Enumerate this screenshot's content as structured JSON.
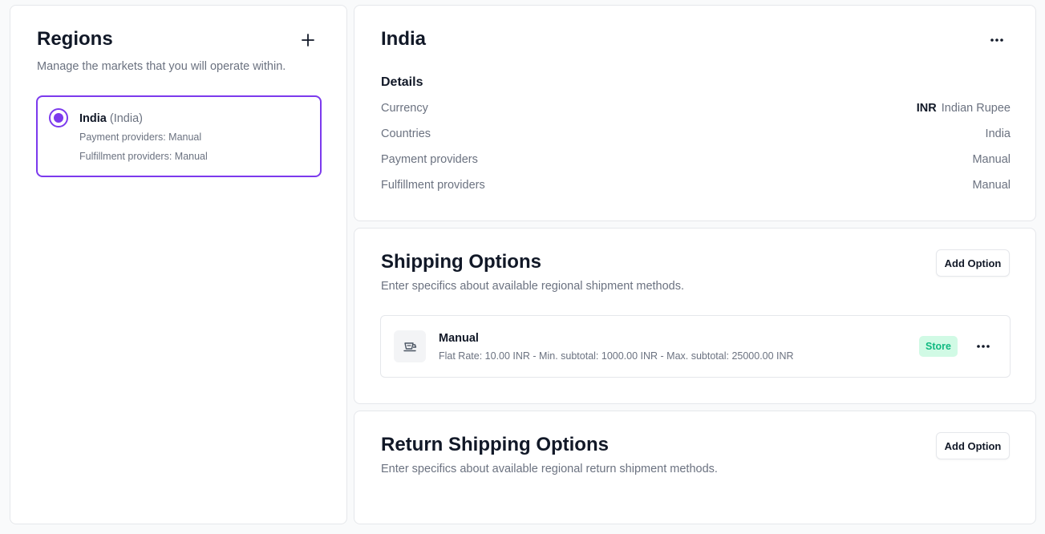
{
  "regions": {
    "title": "Regions",
    "subtitle": "Manage the markets that you will operate within.",
    "items": [
      {
        "name": "India",
        "country": "(India)",
        "payment": "Payment providers: Manual",
        "fulfillment": "Fulfillment providers: Manual",
        "selected": true
      }
    ]
  },
  "details": {
    "title": "India",
    "heading": "Details",
    "rows": [
      {
        "label": "Currency",
        "code": "INR",
        "value": "Indian Rupee"
      },
      {
        "label": "Countries",
        "value": "India"
      },
      {
        "label": "Payment providers",
        "value": "Manual"
      },
      {
        "label": "Fulfillment providers",
        "value": "Manual"
      }
    ]
  },
  "shipping": {
    "title": "Shipping Options",
    "subtitle": "Enter specifics about available regional shipment methods.",
    "add_label": "Add Option",
    "options": [
      {
        "name": "Manual",
        "description": "Flat Rate: 10.00 INR - Min. subtotal: 1000.00 INR - Max. subtotal: 25000.00 INR",
        "badge": "Store"
      }
    ]
  },
  "return_shipping": {
    "title": "Return Shipping Options",
    "subtitle": "Enter specifics about available regional return shipment methods.",
    "add_label": "Add Option"
  },
  "colors": {
    "accent": "#7c3aed",
    "badge_bg": "#d1fae5",
    "badge_text": "#10b981"
  },
  "icons": {
    "add": "plus-icon",
    "more": "more-horizontal-icon",
    "shipping": "shipping-icon"
  }
}
